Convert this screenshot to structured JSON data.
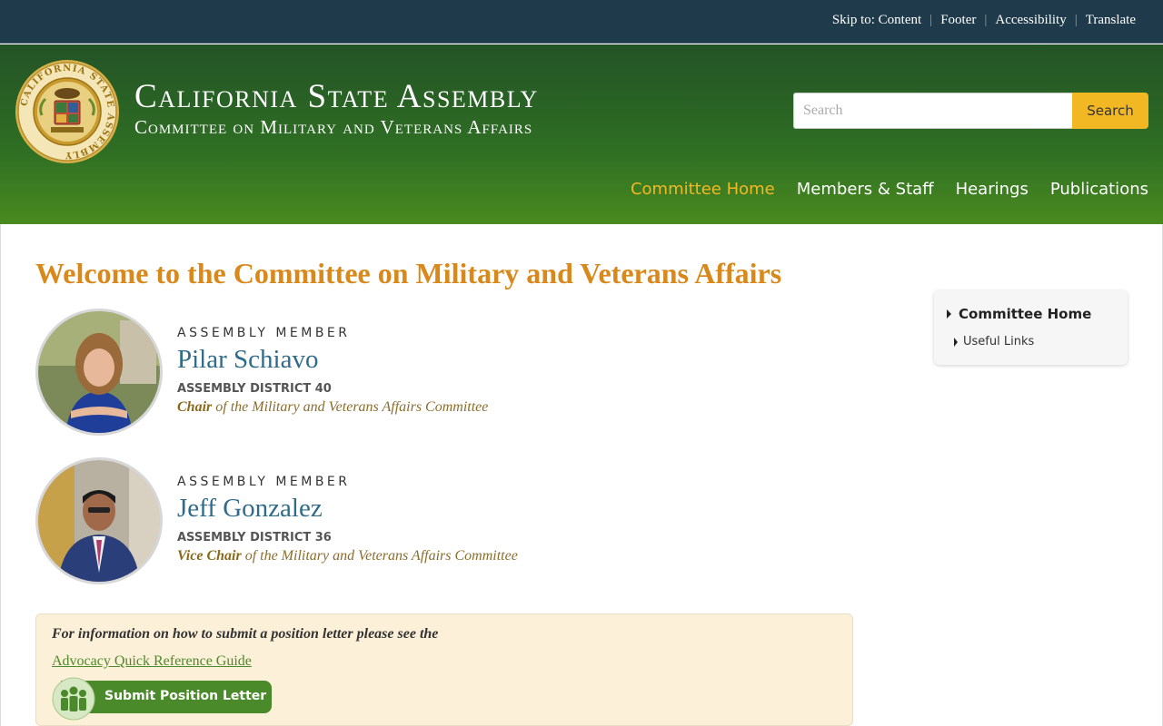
{
  "utility_links": {
    "skip": "Skip to: Content",
    "footer": "Footer",
    "accessibility": "Accessibility",
    "translate": "Translate"
  },
  "header": {
    "title": "California State Assembly",
    "subtitle": "Committee on Military and Veterans Affairs",
    "seal_text": "CALIFORNIA STATE ASSEMBLY"
  },
  "search": {
    "placeholder": "Search",
    "button_label": "Search"
  },
  "nav": {
    "items": [
      {
        "label": "Committee Home",
        "active": true
      },
      {
        "label": "Members & Staff",
        "active": false
      },
      {
        "label": "Hearings",
        "active": false
      },
      {
        "label": "Publications",
        "active": false
      }
    ]
  },
  "main": {
    "heading": "Welcome to the Committee on Military and Veterans Affairs",
    "members": [
      {
        "role": "ASSEMBLY MEMBER",
        "name": "Pilar Schiavo",
        "district": "ASSEMBLY DISTRICT 40",
        "position": "Chair",
        "position_suffix": " of the Military and Veterans Affairs Committee"
      },
      {
        "role": "ASSEMBLY MEMBER",
        "name": "Jeff Gonzalez",
        "district": "ASSEMBLY DISTRICT 36",
        "position": "Vice Chair",
        "position_suffix": " of the Military and Veterans Affairs Committee"
      }
    ],
    "info": {
      "text": "For information on how to submit a position letter please see the",
      "link_label": "Advocacy Quick Reference Guide",
      "button_label": "Submit Position Letter"
    }
  },
  "sidebar": {
    "home": "Committee Home",
    "items": [
      "Useful Links"
    ]
  },
  "colors": {
    "top_bar": "#1f3a4a",
    "header_green": "#2f6f24",
    "accent_gold": "#f2b824",
    "heading_orange": "#d9891c",
    "name_blue": "#2f6b8a",
    "info_bg": "#fdf0d8",
    "button_green": "#4a8a2b"
  }
}
